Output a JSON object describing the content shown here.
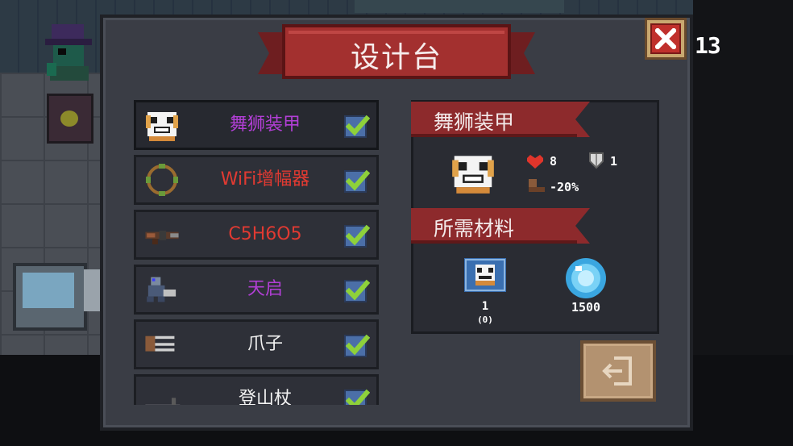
{
  "title": "设计台",
  "counter": "13",
  "icons": {
    "close": "close-x-icon",
    "check": "checkmark-icon",
    "heart": "heart-icon",
    "shield": "shield-icon",
    "boot": "boot-icon",
    "exit": "exit-door-icon",
    "gem": "energy-gem-icon"
  },
  "colors": {
    "purple": "#b23fd6",
    "red": "#e03a32",
    "white": "#f2f2f2",
    "banner": "#8d2a2c",
    "check": "#8ed13a"
  },
  "items": [
    {
      "label": "舞狮装甲",
      "color": "#b23fd6",
      "icon": "lion-dance-armor-icon",
      "checked": true
    },
    {
      "label": "WiFi增幅器",
      "color": "#e03a32",
      "icon": "wifi-amplifier-icon",
      "checked": true
    },
    {
      "label": "C5H6O5",
      "color": "#e03a32",
      "icon": "c5h6o5-gun-icon",
      "checked": true
    },
    {
      "label": "天启",
      "color": "#b23fd6",
      "icon": "apocalypse-mech-icon",
      "checked": true
    },
    {
      "label": "爪子",
      "color": "#f2f2f2",
      "icon": "claw-icon",
      "checked": true
    },
    {
      "label": "登山杖",
      "color": "#f2f2f2",
      "icon": "trekking-pole-icon",
      "checked": true
    }
  ],
  "detail": {
    "name": "舞狮装甲",
    "stats": {
      "health": "8",
      "armor": "1",
      "speed": "-20%"
    },
    "materials_title": "所需材料",
    "materials": [
      {
        "icon": "lion-dance-blueprint-icon",
        "count": "1",
        "sub": "(0)"
      },
      {
        "icon": "energy-gem-icon",
        "count": "1500"
      }
    ]
  }
}
